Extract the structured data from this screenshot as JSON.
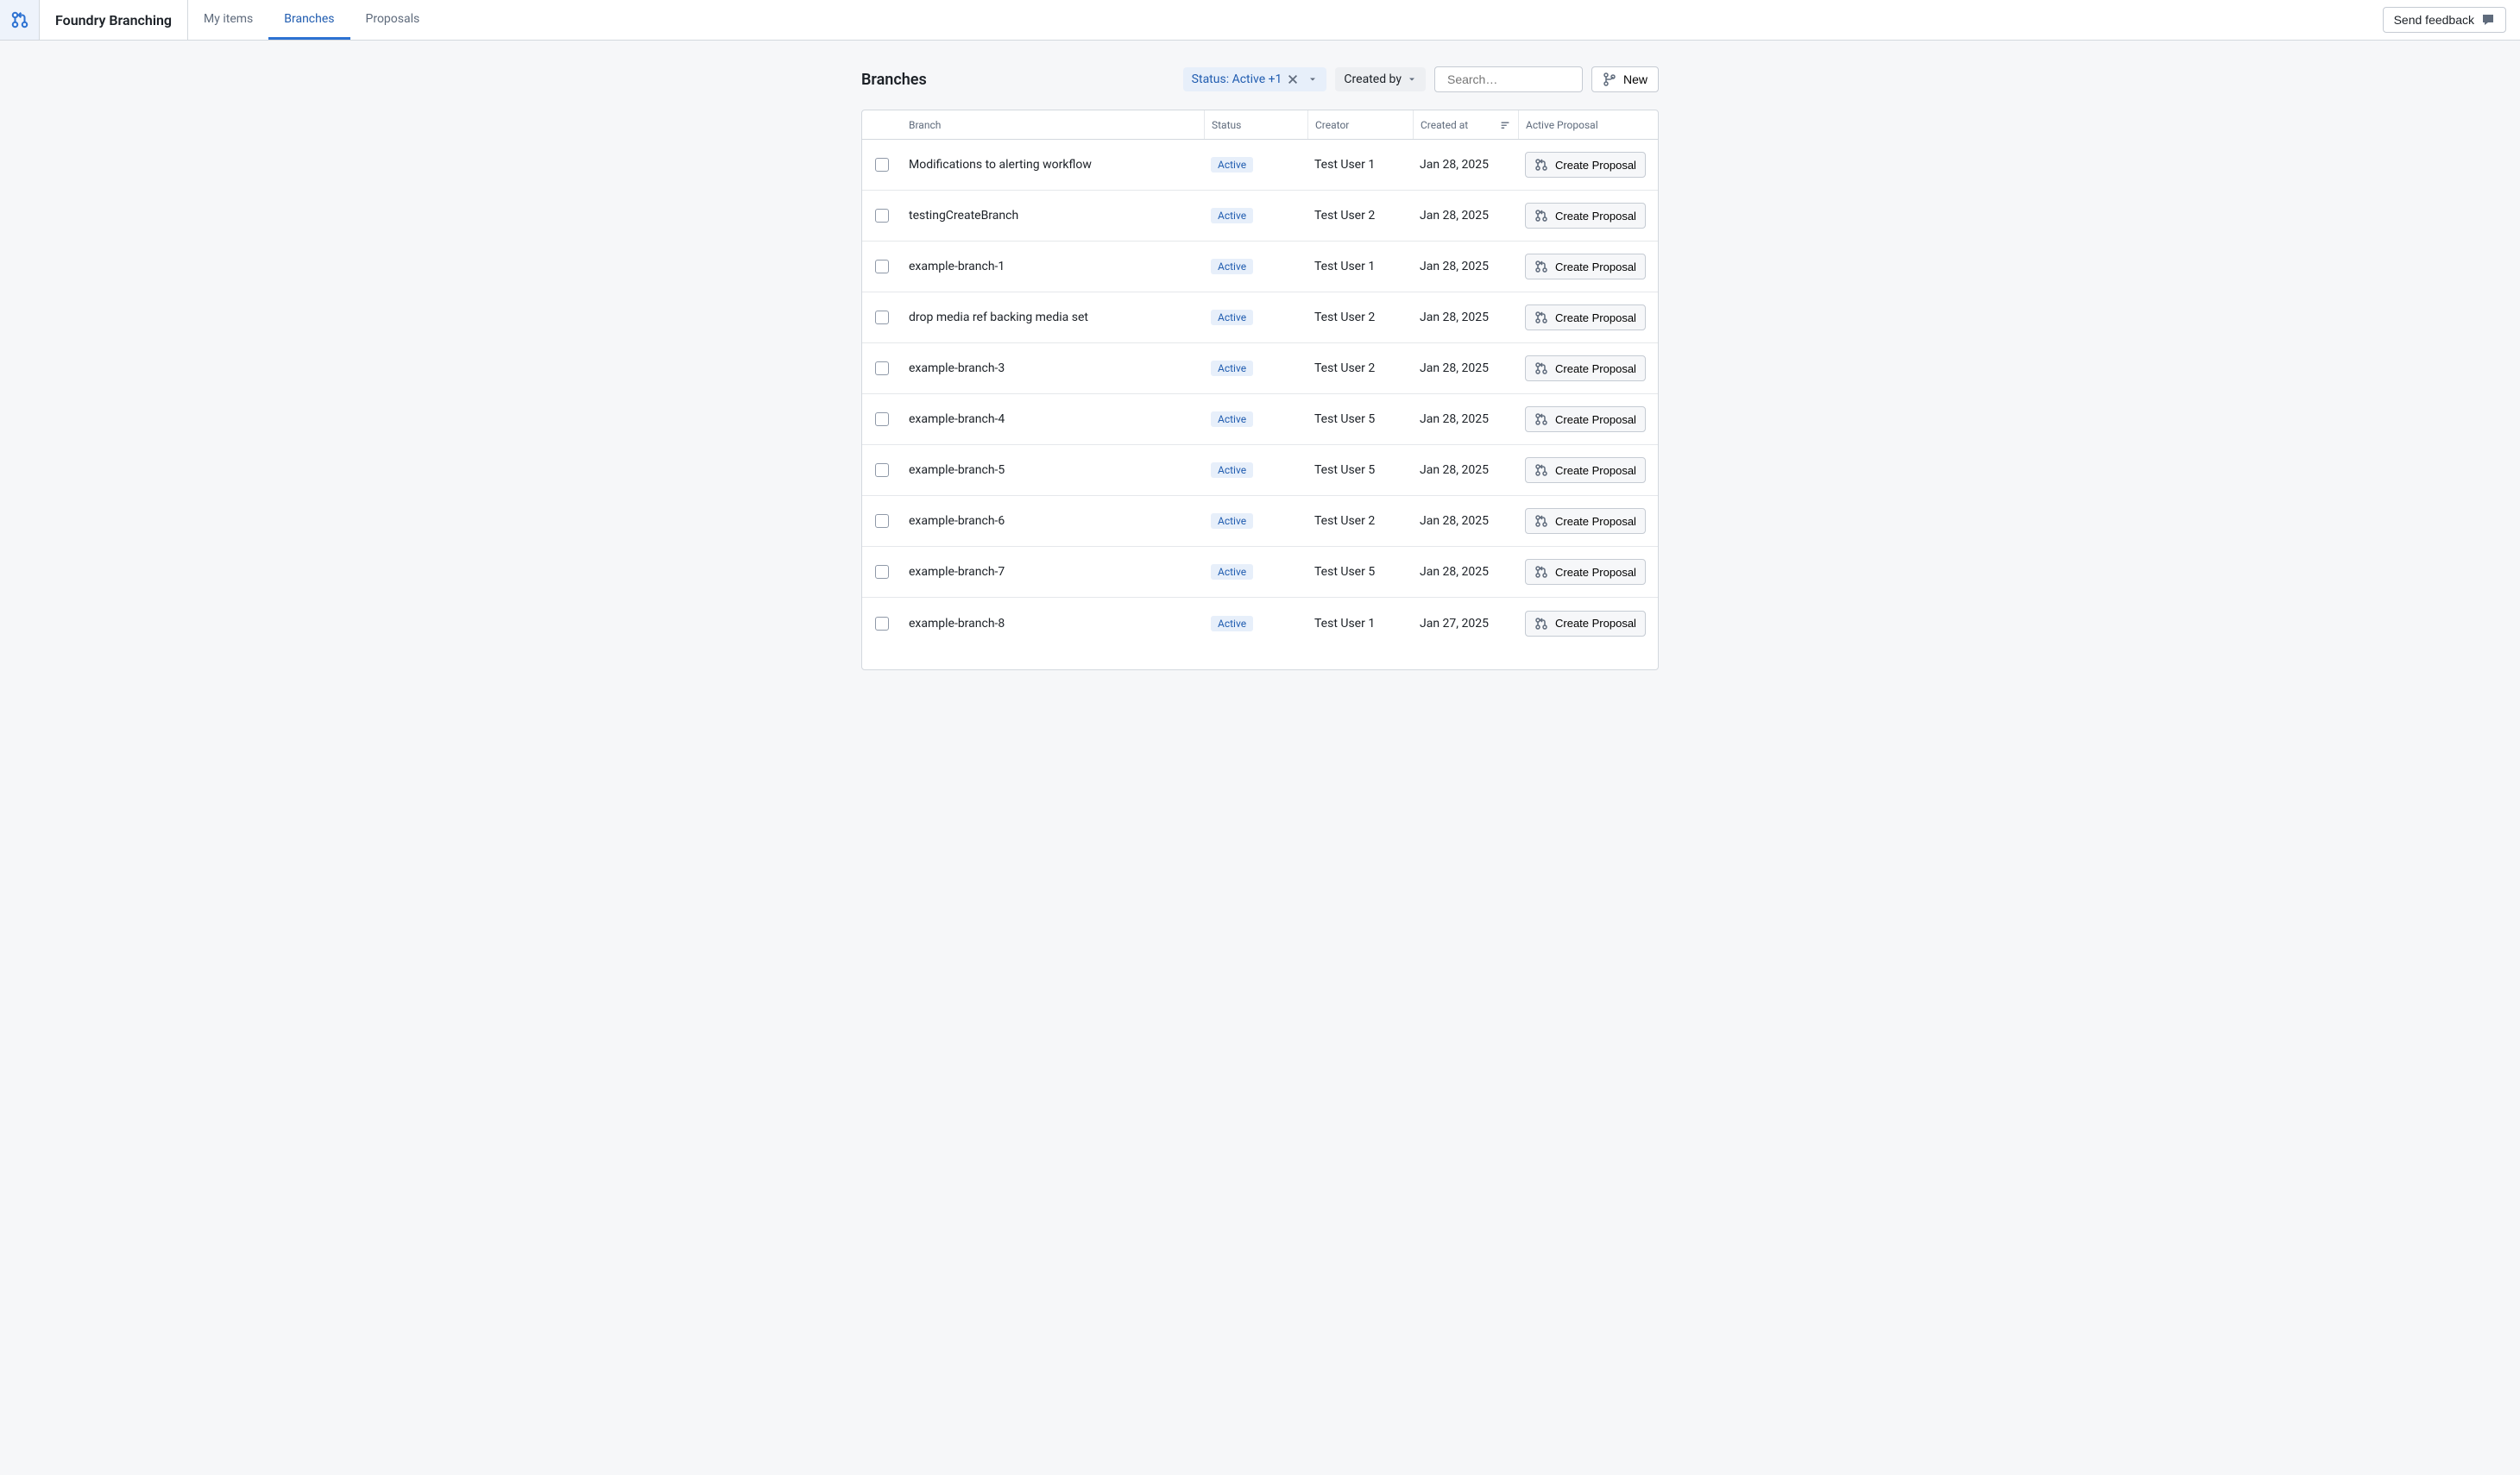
{
  "header": {
    "app_title": "Foundry Branching",
    "tabs": [
      {
        "label": "My items",
        "active": false
      },
      {
        "label": "Branches",
        "active": true
      },
      {
        "label": "Proposals",
        "active": false
      }
    ],
    "feedback_label": "Send feedback"
  },
  "toolbar": {
    "page_title": "Branches",
    "status_filter_label": "Status: Active +1",
    "created_by_label": "Created by",
    "search_placeholder": "Search…",
    "new_label": "New"
  },
  "columns": {
    "branch": "Branch",
    "status": "Status",
    "creator": "Creator",
    "created_at": "Created at",
    "active_proposal": "Active Proposal"
  },
  "create_proposal_label": "Create Proposal",
  "rows": [
    {
      "branch": "Modifications to alerting workflow",
      "status": "Active",
      "creator": "Test User 1",
      "created_at": "Jan 28, 2025"
    },
    {
      "branch": "testingCreateBranch",
      "status": "Active",
      "creator": "Test User 2",
      "created_at": "Jan 28, 2025"
    },
    {
      "branch": "example-branch-1",
      "status": "Active",
      "creator": "Test User 1",
      "created_at": "Jan 28, 2025"
    },
    {
      "branch": "drop media ref backing media set",
      "status": "Active",
      "creator": "Test User 2",
      "created_at": "Jan 28, 2025"
    },
    {
      "branch": "example-branch-3",
      "status": "Active",
      "creator": "Test User 2",
      "created_at": "Jan 28, 2025"
    },
    {
      "branch": "example-branch-4",
      "status": "Active",
      "creator": "Test User 5",
      "created_at": "Jan 28, 2025"
    },
    {
      "branch": "example-branch-5",
      "status": "Active",
      "creator": "Test User 5",
      "created_at": "Jan 28, 2025"
    },
    {
      "branch": "example-branch-6",
      "status": "Active",
      "creator": "Test User 2",
      "created_at": "Jan 28, 2025"
    },
    {
      "branch": "example-branch-7",
      "status": "Active",
      "creator": "Test User 5",
      "created_at": "Jan 28, 2025"
    },
    {
      "branch": "example-branch-8",
      "status": "Active",
      "creator": "Test User 1",
      "created_at": "Jan 27, 2025"
    }
  ]
}
